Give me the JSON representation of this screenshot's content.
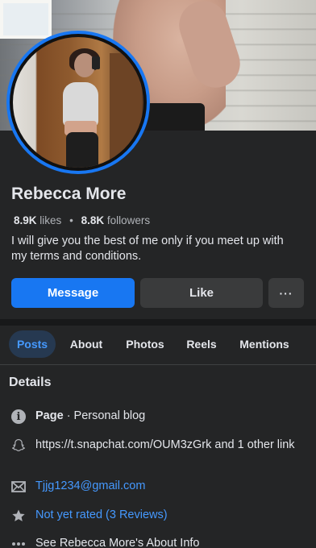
{
  "profile": {
    "name": "Rebecca More",
    "likes_count": "8.9K",
    "likes_label": "likes",
    "followers_count": "8.8K",
    "followers_label": "followers",
    "bio": "I will give you the best of me only if you meet up with my terms and conditions."
  },
  "actions": {
    "message_label": "Message",
    "like_label": "Like",
    "more_label": "···"
  },
  "tabs": [
    {
      "label": "Posts",
      "active": true
    },
    {
      "label": "About"
    },
    {
      "label": "Photos"
    },
    {
      "label": "Reels"
    },
    {
      "label": "Mentions"
    }
  ],
  "details": {
    "title": "Details",
    "page_label": "Page",
    "page_category": " · Personal blog",
    "snapchat": "https://t.snapchat.com/OUM3zGrk and 1 other link",
    "email": "Tjjg1234@gmail.com",
    "rating": "Not yet rated (3 Reviews)",
    "see_about": "See Rebecca More's About Info"
  },
  "icons": {
    "info": "info-icon",
    "snapchat": "snapchat-ghost-icon",
    "email": "envelope-icon",
    "rating": "star-icon",
    "see_about": "ellipsis-icon"
  },
  "colors": {
    "accent": "#1877f2",
    "link": "#4599ff",
    "background": "#242526",
    "button_secondary": "#3a3b3c"
  }
}
